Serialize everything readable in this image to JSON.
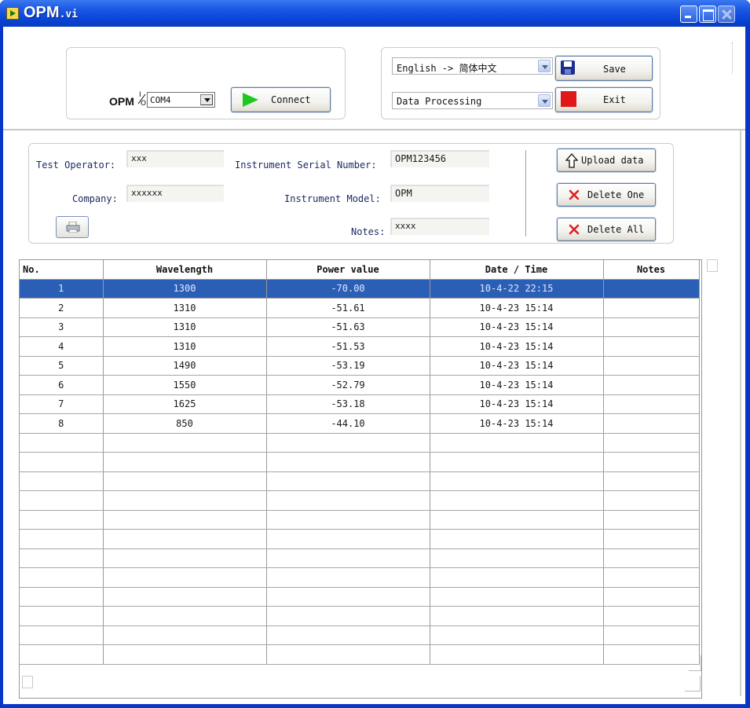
{
  "window": {
    "title": "OPM",
    "title_suffix": ".vi"
  },
  "connection": {
    "label": "OPM",
    "io_icon": "io-icon",
    "port_value": "COM4",
    "connect_label": "Connect"
  },
  "language": {
    "selected": "English -> 简体中文"
  },
  "mode": {
    "selected": "Data Processing"
  },
  "actions": {
    "save_label": "Save",
    "exit_label": "Exit"
  },
  "info": {
    "operator_label": "Test Operator:",
    "operator_value": "xxx",
    "company_label": "Company:",
    "company_value": "xxxxxx",
    "serial_label": "Instrument Serial Number:",
    "serial_value": "OPM123456",
    "model_label": "Instrument Model:",
    "model_value": "OPM",
    "notes_label": "Notes:",
    "notes_value": "xxxx",
    "upload_label": "Upload data",
    "delete_one_label": "Delete One",
    "delete_all_label": "Delete All"
  },
  "table": {
    "headers": [
      "No.",
      "Wavelength",
      "Power value",
      "Date / Time",
      "Notes"
    ],
    "rows": [
      [
        "1",
        "1300",
        "-70.00",
        "10-4-22 22:15",
        ""
      ],
      [
        "2",
        "1310",
        "-51.61",
        "10-4-23 15:14",
        ""
      ],
      [
        "3",
        "1310",
        "-51.63",
        "10-4-23 15:14",
        ""
      ],
      [
        "4",
        "1310",
        "-51.53",
        "10-4-23 15:14",
        ""
      ],
      [
        "5",
        "1490",
        "-53.19",
        "10-4-23 15:14",
        ""
      ],
      [
        "6",
        "1550",
        "-52.79",
        "10-4-23 15:14",
        ""
      ],
      [
        "7",
        "1625",
        "-53.18",
        "10-4-23 15:14",
        ""
      ],
      [
        "8",
        "850",
        "-44.10",
        "10-4-23 15:14",
        ""
      ]
    ],
    "selected_row": 0,
    "empty_rows": 12
  },
  "colors": {
    "titlebar": "#0a45d8",
    "selection": "#2b5fb6",
    "connect_arrow": "#1fc81f",
    "exit_square": "#e01818",
    "delete_x": "#e02020"
  }
}
